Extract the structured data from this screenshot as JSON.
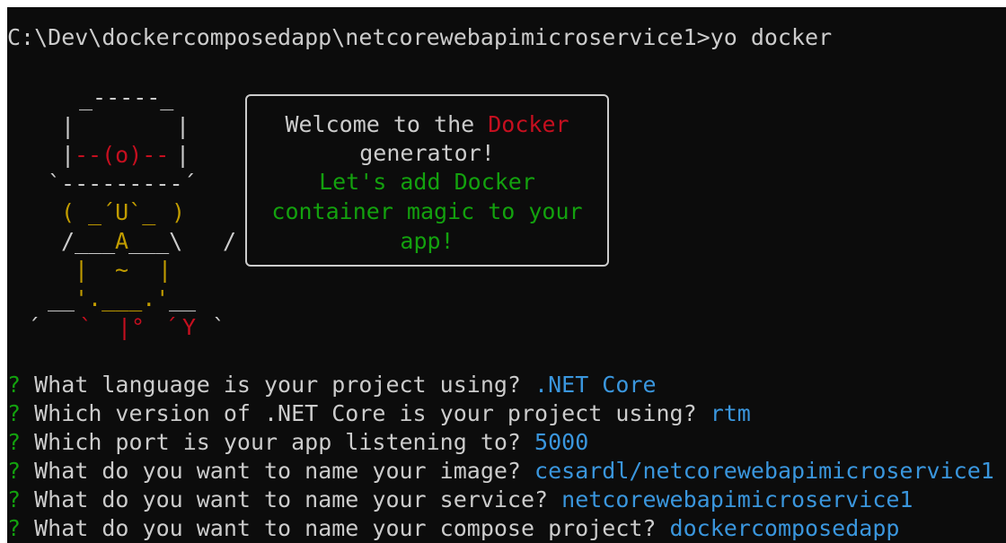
{
  "prompt_line": "C:\\Dev\\dockercomposedapp\\netcorewebapimicroservice1>yo docker",
  "art": {
    "hat_top": "_-----_",
    "hat_side_left": "|",
    "hat_side_right": "|",
    "eye_left": "|",
    "eye_mid": "--(o)--",
    "eye_right": "|",
    "brim": "`---------´",
    "face_paren_left": "(",
    "face_mid": " _´U`_ ",
    "face_paren_right": ")",
    "body_left": "/___",
    "body_A": "A",
    "body_right": "___\\",
    "slash": "/",
    "torso_left": "|",
    "torso_mid": " ~ ",
    "torso_right": "|",
    "legs": "'.___.'",
    "ground_left": "__",
    "ground_right": "__",
    "feet_left": "´",
    "feet_tick": "`",
    "feet_bar": "|°",
    "feet_y_tick": "´",
    "feet_y": "Y",
    "feet_end": "`"
  },
  "bubble": {
    "line1_prefix": "Welcome to the ",
    "line1_brand": "Docker",
    "line2": "generator!",
    "line3": "Let's add Docker",
    "line4": "container magic to your",
    "line5": "app!"
  },
  "questions": [
    {
      "mark": "?",
      "text": "What language is your project using?",
      "answer": ".NET Core"
    },
    {
      "mark": "?",
      "text": "Which version of .NET Core is your project using?",
      "answer": "rtm"
    },
    {
      "mark": "?",
      "text": "Which port is your app listening to?",
      "answer": "5000"
    },
    {
      "mark": "?",
      "text": "What do you want to name your image?",
      "answer": "cesardl/netcorewebapimicroservice1"
    },
    {
      "mark": "?",
      "text": "What do you want to name your service?",
      "answer": "netcorewebapimicroservice1"
    },
    {
      "mark": "?",
      "text": "What do you want to name your compose project?",
      "answer": "dockercomposedapp"
    }
  ],
  "colors": {
    "background": "#0c0c0c",
    "text": "#cccccc",
    "accent_green": "#13a10e",
    "accent_red": "#c50f1f",
    "accent_yellow": "#c19c00",
    "answer_cyan": "#3a96dd"
  }
}
